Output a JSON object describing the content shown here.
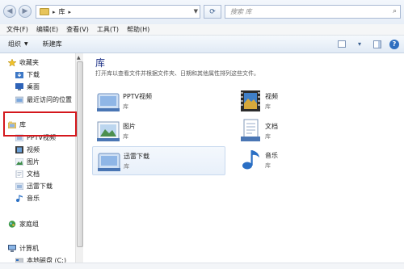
{
  "address": {
    "path_segment": "库",
    "separator": "▸"
  },
  "search": {
    "placeholder": "搜索 库"
  },
  "menu": [
    "文件(F)",
    "编辑(E)",
    "查看(V)",
    "工具(T)",
    "帮助(H)"
  ],
  "toolbar": {
    "organize": "组织",
    "new_library": "新建库"
  },
  "nav": {
    "favorites": "收藏夹",
    "downloads": "下载",
    "desktop": "桌面",
    "recent": "最近访问的位置",
    "libraries": "库",
    "pptv": "PPTV视频",
    "videos": "视频",
    "pictures": "图片",
    "documents": "文档",
    "xunlei": "迅雷下载",
    "music": "音乐",
    "homegroup": "家庭组",
    "computer": "计算机",
    "local_disk": "本地磁盘 (C:)"
  },
  "content": {
    "title": "库",
    "description": "打开库以查看文件并根据文件夹、日期和其他属性排列这些文件。",
    "items": [
      {
        "name": "PPTV视频",
        "type": "库"
      },
      {
        "name": "视频",
        "type": "库"
      },
      {
        "name": "图片",
        "type": "库"
      },
      {
        "name": "文档",
        "type": "库"
      },
      {
        "name": "迅雷下载",
        "type": "库"
      },
      {
        "name": "音乐",
        "type": "库"
      }
    ]
  },
  "colors": {
    "highlight_box": "#d4171c",
    "title_blue": "#1e3287"
  }
}
